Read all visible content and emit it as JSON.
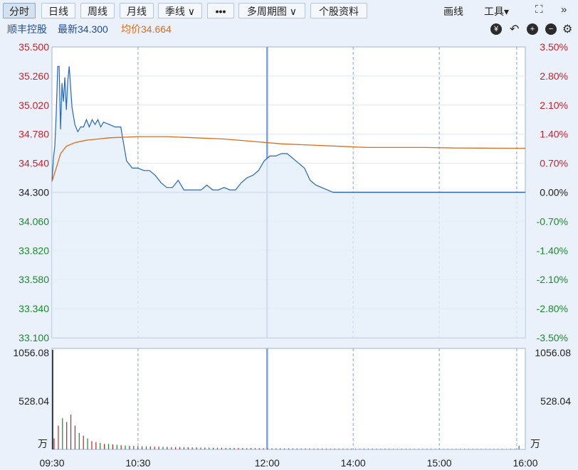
{
  "toolbar": {
    "tabs": [
      "分时",
      "日线",
      "周线",
      "月线",
      "季线 ∨",
      "•••",
      "多周期图 ∨",
      "个股资料"
    ],
    "draw_label": "画线",
    "tools_label": "工具▾",
    "expand_icon": "expand-icon",
    "collapse_icon": "double-chevron-right-icon"
  },
  "info": {
    "name": "顺丰控股",
    "last": "最新34.300",
    "avg": "均价34.664"
  },
  "colors": {
    "price": "#2a66b8",
    "avg": "#d96c1e",
    "up": "#c8202a",
    "down": "#1a8a2e",
    "grid": "#bcd0e8"
  },
  "chart_data": {
    "type": "line",
    "price_ticks": [
      "35.500",
      "35.260",
      "35.020",
      "34.780",
      "34.540",
      "34.300",
      "34.060",
      "33.820",
      "33.580",
      "33.340",
      "33.100"
    ],
    "pct_ticks": [
      "3.50%",
      "2.80%",
      "2.10%",
      "1.40%",
      "0.70%",
      "0.00%",
      "-0.70%",
      "-1.40%",
      "-2.10%",
      "-2.80%",
      "-3.50%"
    ],
    "ylim": [
      33.1,
      35.5
    ],
    "prev_close": 34.3,
    "time_ticks": [
      "09:30",
      "10:30",
      "12:00",
      "14:00",
      "15:00",
      "16:00"
    ],
    "volume_ticks": [
      "1056.08",
      "528.04"
    ],
    "volume_unit": "万",
    "volume_max": 1056.08,
    "series": [
      {
        "name": "最新",
        "x": [
          0,
          1,
          2,
          3,
          4,
          5,
          6,
          7,
          8,
          9,
          10,
          11,
          12,
          14,
          16,
          18,
          20,
          22,
          24,
          26,
          28,
          30,
          32,
          34,
          36,
          40,
          44,
          48,
          52,
          56,
          60,
          64,
          68,
          72,
          76,
          80,
          84,
          88,
          92,
          96,
          100,
          104,
          108,
          112,
          116,
          120,
          124,
          128,
          132,
          136,
          140,
          144,
          148,
          152,
          156,
          160,
          164,
          168,
          172,
          176,
          180,
          184,
          188,
          192,
          196,
          200,
          204,
          208,
          212,
          216,
          220,
          224,
          228,
          232,
          236,
          240,
          244,
          248,
          252,
          256,
          260,
          264,
          268,
          272,
          276,
          280,
          284,
          288,
          292,
          296,
          300,
          304,
          308,
          312,
          316,
          320,
          324,
          328,
          330
        ],
        "values": [
          34.39,
          34.58,
          34.68,
          34.95,
          35.34,
          35.34,
          34.82,
          35.2,
          35.05,
          35.25,
          34.98,
          35.22,
          35.34,
          35.0,
          34.86,
          34.8,
          34.84,
          34.84,
          34.9,
          34.84,
          34.9,
          34.86,
          34.9,
          34.84,
          34.88,
          34.86,
          34.84,
          34.84,
          34.56,
          34.5,
          34.5,
          34.48,
          34.48,
          34.44,
          34.38,
          34.34,
          34.34,
          34.4,
          34.32,
          34.32,
          34.32,
          34.32,
          34.36,
          34.32,
          34.32,
          34.34,
          34.32,
          34.32,
          34.38,
          34.42,
          34.44,
          34.48,
          34.56,
          34.6,
          34.6,
          34.62,
          34.62,
          34.58,
          34.54,
          34.5,
          34.4,
          34.36,
          34.34,
          34.32,
          34.3,
          34.3,
          34.3,
          34.3,
          34.3,
          34.3,
          34.3,
          34.3,
          34.3,
          34.3,
          34.3,
          34.3,
          34.3,
          34.3,
          34.3,
          34.3,
          34.3,
          34.3,
          34.3,
          34.3,
          34.3,
          34.3,
          34.3,
          34.3,
          34.3,
          34.3,
          34.3,
          34.3,
          34.3,
          34.3,
          34.3,
          34.3,
          34.3,
          34.3,
          34.3
        ]
      },
      {
        "name": "均价",
        "x": [
          0,
          3,
          6,
          10,
          16,
          24,
          40,
          60,
          80,
          100,
          120,
          140,
          160,
          180,
          200,
          220,
          240,
          260,
          280,
          300,
          320,
          330
        ],
        "values": [
          34.39,
          34.5,
          34.62,
          34.68,
          34.71,
          34.73,
          34.75,
          34.76,
          34.76,
          34.75,
          34.74,
          34.72,
          34.7,
          34.69,
          34.68,
          34.67,
          34.67,
          34.67,
          34.666,
          34.665,
          34.664,
          34.664
        ]
      }
    ],
    "volume_bars": [
      120,
      260,
      340,
      300,
      380,
      260,
      180,
      150,
      120,
      90,
      80,
      70,
      60,
      60,
      55,
      50,
      45,
      42,
      40,
      38,
      36,
      34,
      34,
      32,
      30,
      30,
      28,
      28,
      26,
      26,
      26,
      24,
      24,
      22,
      22,
      20,
      20,
      20,
      18,
      18,
      18,
      16,
      16,
      16,
      15,
      15,
      14,
      14,
      14,
      13,
      13,
      12,
      12,
      12,
      11,
      11,
      11,
      10,
      10,
      10,
      10,
      9,
      9,
      9,
      9,
      8,
      8,
      8,
      8,
      8,
      8,
      8,
      7,
      7,
      7,
      7,
      7,
      7,
      7,
      7,
      7,
      6,
      6,
      6,
      6,
      6,
      6,
      6,
      6,
      6,
      6,
      5,
      5,
      5,
      5,
      5,
      5,
      5,
      5,
      5,
      5,
      5,
      5,
      5,
      5,
      5,
      5,
      5,
      5,
      5,
      5,
      40
    ],
    "volume_colors": [
      "up",
      "up",
      "down",
      "up",
      "up",
      "up",
      "down",
      "up",
      "down",
      "up",
      "up",
      "down",
      "up",
      "down",
      "up",
      "down",
      "up",
      "down",
      "up",
      "down"
    ]
  }
}
